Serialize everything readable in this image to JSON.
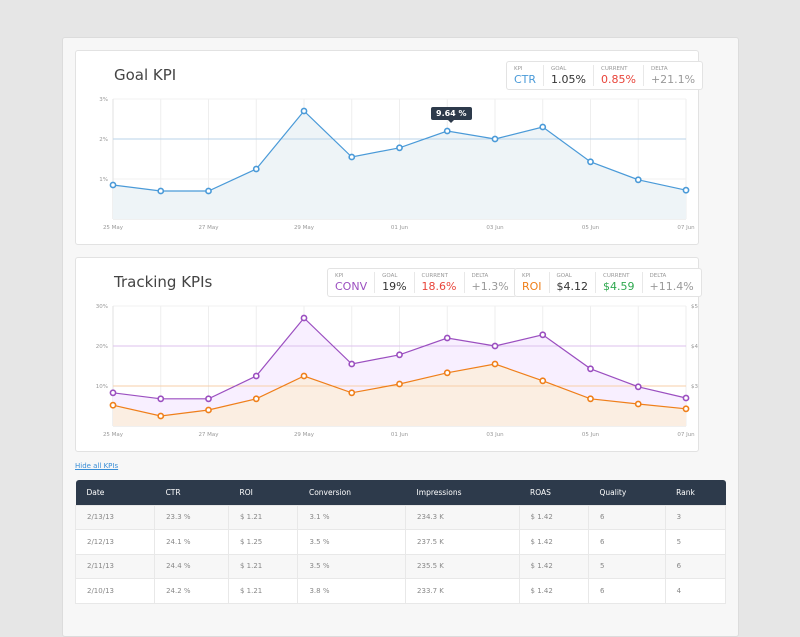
{
  "goal_panel": {
    "title": "Goal KPI",
    "kpi": {
      "kpi_label": "KPI",
      "kpi": "CTR",
      "goal_label": "GOAL",
      "goal": "1.05%",
      "current_label": "CURRENT",
      "current": "0.85%",
      "delta_label": "DELTA",
      "delta": "+21.1%"
    },
    "tooltip": "9.64 %"
  },
  "tracking_panel": {
    "title": "Tracking KPIs",
    "kpis": [
      {
        "kpi_label": "KPI",
        "kpi": "CONV",
        "goal_label": "GOAL",
        "goal": "19%",
        "current_label": "CURRENT",
        "current": "18.6%",
        "delta_label": "DELTA",
        "delta": "+1.3%"
      },
      {
        "kpi_label": "KPI",
        "kpi": "ROI",
        "goal_label": "GOAL",
        "goal": "$4.12",
        "current_label": "CURRENT",
        "current": "$4.59",
        "delta_label": "DELTA",
        "delta": "+11.4%"
      }
    ]
  },
  "colors": {
    "ctr": "#4a9ad8",
    "conv": "#9b4fc0",
    "roi": "#ef7f1a",
    "red": "#e8443a",
    "green": "#2fa84f",
    "header": "#2d3a4b"
  },
  "chart_data": [
    {
      "type": "area",
      "title": "Goal KPI",
      "x_labels": [
        "25 May",
        "",
        "27 May",
        "",
        "29 May",
        "",
        "01 Jun",
        "",
        "03 Jun",
        "",
        "05 Jun",
        "",
        "07 Jun"
      ],
      "y_ticks": [
        "1%",
        "2%",
        "3%"
      ],
      "ylim": [
        0,
        3
      ],
      "goal_line": 2,
      "series": [
        {
          "name": "CTR",
          "color": "#4a9ad8",
          "fill": "#eef4f7",
          "values": [
            0.85,
            0.7,
            0.7,
            1.25,
            2.7,
            1.55,
            1.78,
            2.2,
            2.0,
            2.3,
            1.43,
            0.98,
            0.72
          ]
        }
      ],
      "grid": true
    },
    {
      "type": "area",
      "title": "Tracking KPIs",
      "x_labels": [
        "25 May",
        "",
        "27 May",
        "",
        "29 May",
        "",
        "01 Jun",
        "",
        "03 Jun",
        "",
        "05 Jun",
        "",
        "07 Jun"
      ],
      "y_ticks": [
        "10%",
        "20%",
        "30%"
      ],
      "ylim": [
        0,
        30
      ],
      "y2_ticks": [
        "$3",
        "$4",
        "$5"
      ],
      "y2lim": [
        2,
        5
      ],
      "series": [
        {
          "name": "CONV",
          "axis": "left",
          "color": "#9b4fc0",
          "fill": "#f8efff",
          "goal_line": 20,
          "goal_color": "#dcc0ee",
          "values": [
            8.3,
            6.8,
            6.8,
            12.5,
            27,
            15.5,
            17.8,
            22,
            20,
            22.8,
            14.3,
            9.8,
            7
          ]
        },
        {
          "name": "ROI",
          "axis": "right",
          "color": "#ef7f1a",
          "fill": "#fbeee2",
          "goal_line": 3,
          "goal_color": "#f7cfa8",
          "values": [
            2.52,
            2.25,
            2.4,
            2.68,
            3.25,
            2.83,
            3.05,
            3.33,
            3.55,
            3.13,
            2.68,
            2.55,
            2.43
          ]
        }
      ],
      "grid": true
    }
  ],
  "hide_link": "Hide all KPIs",
  "table": {
    "headers": [
      "Date",
      "CTR",
      "ROI",
      "Conversion",
      "Impressions",
      "ROAS",
      "Quality",
      "Rank"
    ],
    "rows": [
      [
        "2/13/13",
        "23.3 %",
        "$ 1.21",
        "3.1 %",
        "234.3 K",
        "$ 1.42",
        "6",
        "3"
      ],
      [
        "2/12/13",
        "24.1 %",
        "$ 1.25",
        "3.5 %",
        "237.5 K",
        "$ 1.42",
        "6",
        "5"
      ],
      [
        "2/11/13",
        "24.4 %",
        "$ 1.21",
        "3.5 %",
        "235.5 K",
        "$ 1.42",
        "5",
        "6"
      ],
      [
        "2/10/13",
        "24.2 %",
        "$ 1.21",
        "3.8 %",
        "233.7 K",
        "$ 1.42",
        "6",
        "4"
      ]
    ]
  }
}
